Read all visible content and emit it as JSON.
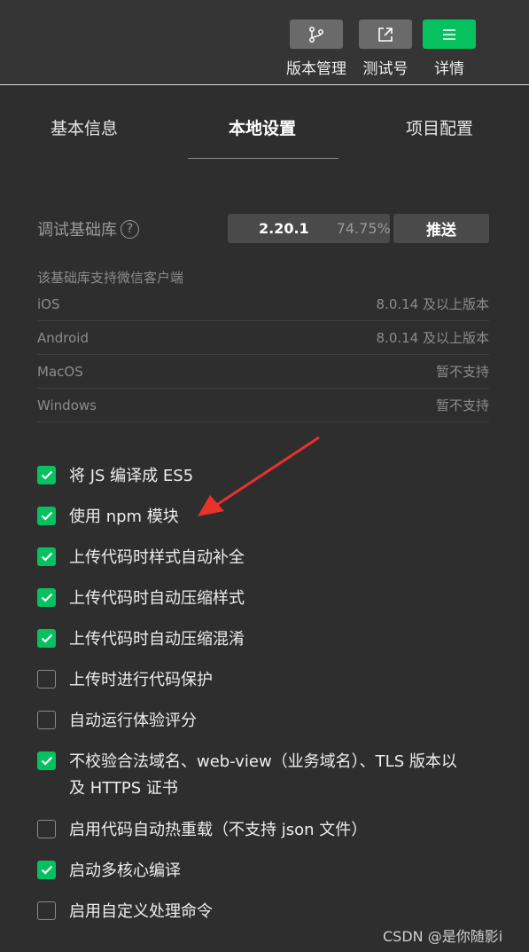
{
  "toolbar": {
    "items": [
      {
        "label": "版本管理",
        "icon": "branch-icon"
      },
      {
        "label": "测试号",
        "icon": "external-link-icon"
      },
      {
        "label": "详情",
        "icon": "menu-icon",
        "active": true
      }
    ],
    "accent_color": "#07c160"
  },
  "tabs": [
    {
      "label": "基本信息"
    },
    {
      "label": "本地设置",
      "active": true
    },
    {
      "label": "项目配置"
    }
  ],
  "base_library": {
    "label": "调试基础库",
    "help_icon": "?",
    "version": "2.20.1",
    "coverage": "74.75%",
    "push_label": "推送"
  },
  "support": {
    "title": "该基础库支持微信客户端",
    "rows": [
      {
        "platform": "iOS",
        "status": "8.0.14 及以上版本"
      },
      {
        "platform": "Android",
        "status": "8.0.14 及以上版本"
      },
      {
        "platform": "MacOS",
        "status": "暂不支持"
      },
      {
        "platform": "Windows",
        "status": "暂不支持"
      }
    ]
  },
  "options": [
    {
      "label": "将 JS 编译成 ES5",
      "checked": true
    },
    {
      "label": "使用 npm 模块",
      "checked": true
    },
    {
      "label": "上传代码时样式自动补全",
      "checked": true
    },
    {
      "label": "上传代码时自动压缩样式",
      "checked": true
    },
    {
      "label": "上传代码时自动压缩混淆",
      "checked": true
    },
    {
      "label": "上传时进行代码保护",
      "checked": false
    },
    {
      "label": "自动运行体验评分",
      "checked": false
    },
    {
      "label": "不校验合法域名、web-view（业务域名）、TLS 版本以及 HTTPS 证书",
      "checked": true
    },
    {
      "label": "启用代码自动热重载（不支持 json 文件）",
      "checked": false
    },
    {
      "label": "启动多核心编译",
      "checked": true
    },
    {
      "label": "启用自定义处理命令",
      "checked": false
    }
  ],
  "watermark": "CSDN @是你随影i"
}
